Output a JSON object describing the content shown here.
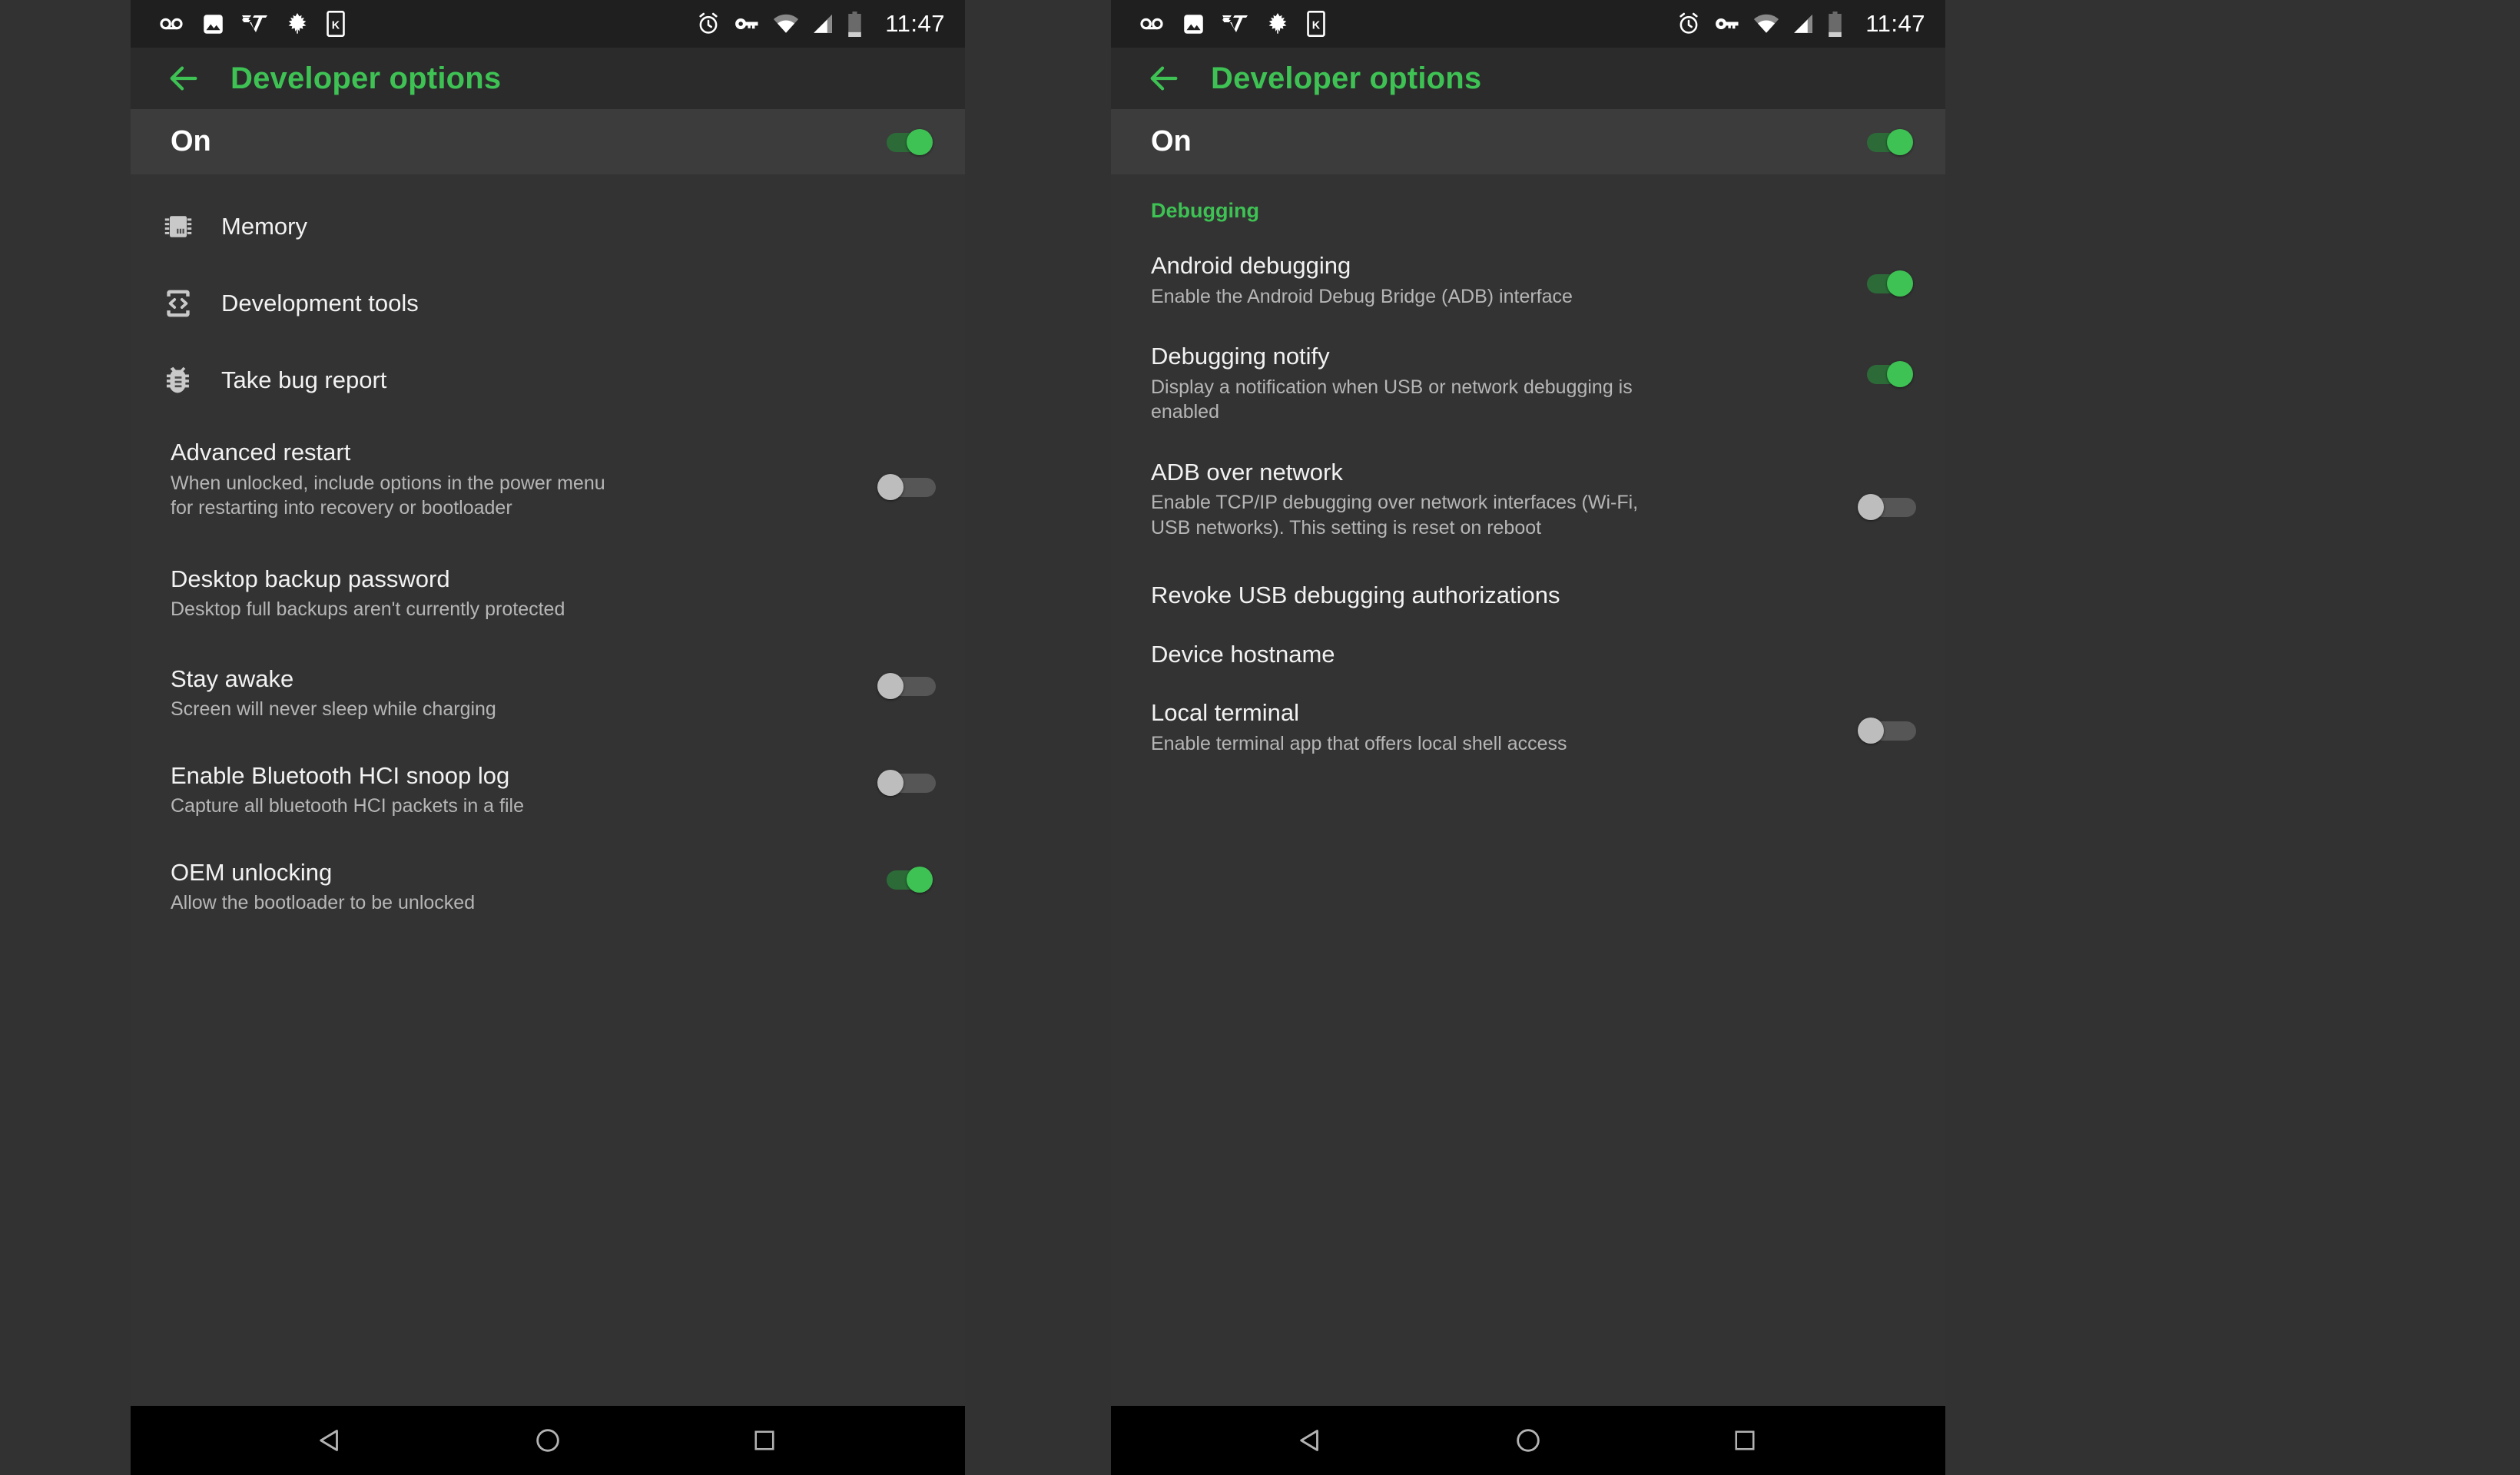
{
  "statusbar": {
    "icons_left": [
      "voicemail-icon",
      "photo-icon",
      "v-logo-icon",
      "leaf-icon",
      "k-box-icon"
    ],
    "icons_right": [
      "alarm-icon",
      "key-icon",
      "wifi-icon",
      "signal-icon",
      "battery-icon"
    ],
    "clock": "11:47"
  },
  "colors": {
    "accent_green": "#3ec254",
    "toggle_on_track": "#2c6b38",
    "toggle_off_thumb": "#bdbdbd",
    "window_bg": "#333333",
    "actionbar_bg": "#2b2b2b",
    "master_bg": "#3c3c3c",
    "navbar_bg": "#000000"
  },
  "actionbar": {
    "back_icon": "arrow-left-icon",
    "title": "Developer options"
  },
  "master": {
    "label": "On",
    "state": "on"
  },
  "left_screen": {
    "items": [
      {
        "icon": "memory-chip-icon",
        "title": "Memory",
        "sub": null,
        "control": null
      },
      {
        "icon": "development-tools-icon",
        "title": "Development tools",
        "sub": null,
        "control": null
      },
      {
        "icon": "bug-report-icon",
        "title": "Take bug report",
        "sub": null,
        "control": null
      },
      {
        "icon": null,
        "title": "Advanced restart",
        "sub": "When unlocked, include options in the power menu for restarting into recovery or bootloader",
        "control": "off"
      },
      {
        "icon": null,
        "title": "Desktop backup password",
        "sub": "Desktop full backups aren't currently protected",
        "control": null
      },
      {
        "icon": null,
        "title": "Stay awake",
        "sub": "Screen will never sleep while charging",
        "control": "off"
      },
      {
        "icon": null,
        "title": "Enable Bluetooth HCI snoop log",
        "sub": "Capture all bluetooth HCI packets in a file",
        "control": "off"
      },
      {
        "icon": null,
        "title": "OEM unlocking",
        "sub": "Allow the bootloader to be unlocked",
        "control": "on"
      }
    ]
  },
  "right_screen": {
    "section": "Debugging",
    "items": [
      {
        "title": "Android debugging",
        "sub": "Enable the Android Debug Bridge (ADB) interface",
        "control": "on"
      },
      {
        "title": "Debugging notify",
        "sub": "Display a notification when USB or network debugging is enabled",
        "control": "on"
      },
      {
        "title": "ADB over network",
        "sub": "Enable TCP/IP debugging over network interfaces (Wi-Fi, USB networks). This setting is reset on reboot",
        "control": "off"
      },
      {
        "title": "Revoke USB debugging authorizations",
        "sub": null,
        "control": null
      },
      {
        "title": "Device hostname",
        "sub": null,
        "control": null
      },
      {
        "title": "Local terminal",
        "sub": "Enable terminal app that offers local shell access",
        "control": "off"
      }
    ]
  },
  "navbar": {
    "buttons": [
      "back-triangle-icon",
      "home-circle-icon",
      "recents-square-icon"
    ]
  }
}
